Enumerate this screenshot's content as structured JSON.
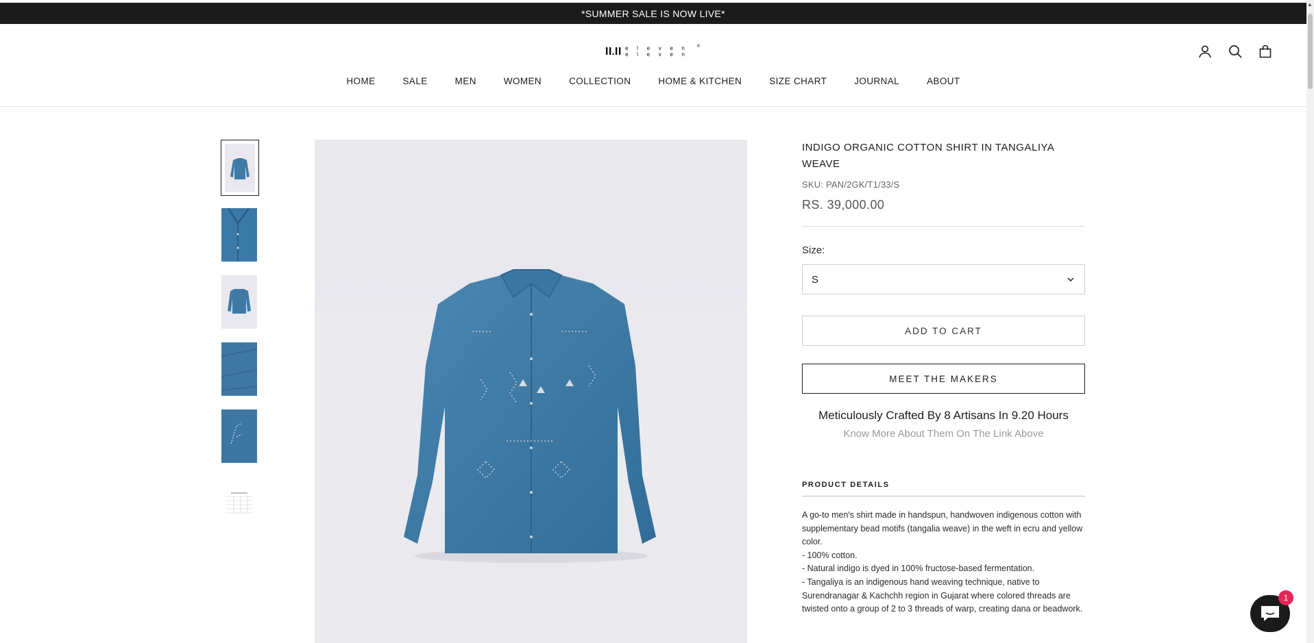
{
  "announcement": "*SUMMER SALE IS NOW LIVE*",
  "brand": {
    "logo_name": "eleven eleven"
  },
  "header_icons": [
    "account-icon",
    "search-icon",
    "cart-icon"
  ],
  "nav": [
    "HOME",
    "SALE",
    "MEN",
    "WOMEN",
    "COLLECTION",
    "HOME & KITCHEN",
    "SIZE CHART",
    "JOURNAL",
    "ABOUT"
  ],
  "product": {
    "title": "INDIGO ORGANIC COTTON SHIRT IN TANGALIYA WEAVE",
    "sku": "SKU: PAN/2GK/T1/33/S",
    "price": "RS. 39,000.00",
    "size_label": "Size:",
    "size_value": "S",
    "add_to_cart": "ADD TO CART",
    "meet_makers": "MEET THE MAKERS",
    "crafted_text": "Meticulously Crafted By 8 Artisans In 9.20 Hours",
    "know_more": "Know More About Them On The Link Above",
    "details_heading": "PRODUCT DETAILS",
    "details": [
      "A go-to men's shirt made in handspun, handwoven indigenous cotton with supplementary bead motifs (tangalia weave) in the weft in ecru and yellow color.",
      "- 100% cotton.",
      "- Natural indigo is dyed in 100% fructose-based fermentation.",
      "- Tangaliya is an indigenous hand weaving technique, native to Surendranagar & Kachchh region in Gujarat where colored threads are twisted onto a group of 2 to 3 threads of warp, creating dana or beadwork."
    ]
  },
  "chat": {
    "badge_count": "1"
  },
  "colors": {
    "topbar": "#1b1b1b",
    "indigo": "#3f7aa6",
    "badge": "#e5245a"
  }
}
